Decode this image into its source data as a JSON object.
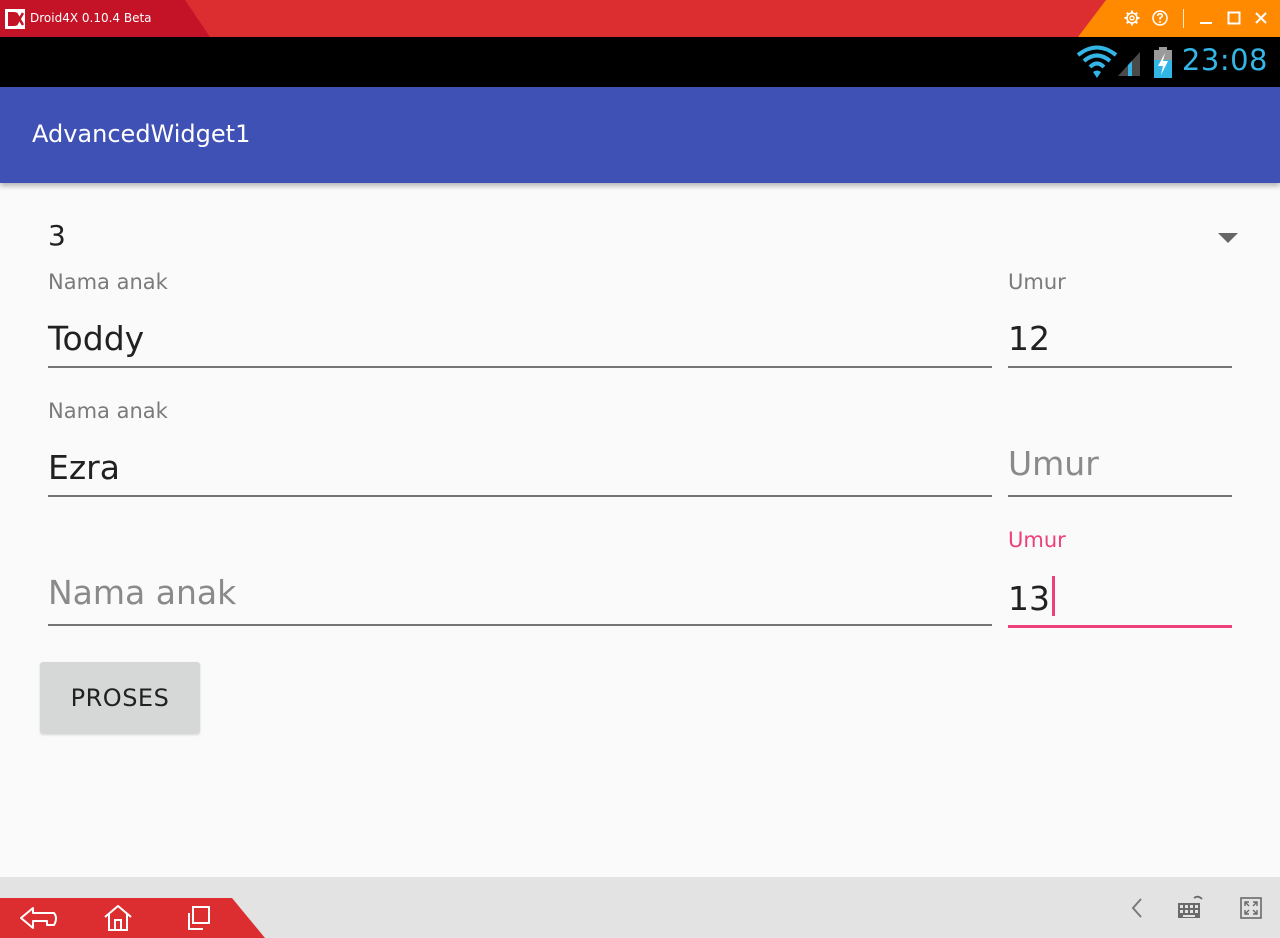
{
  "emulator": {
    "title": "Droid4X 0.10.4 Beta",
    "controls": [
      "gear-icon",
      "help-icon",
      "minimize-icon",
      "maximize-icon",
      "close-icon"
    ],
    "bottom_left_controls": [
      "back-icon",
      "home-icon",
      "recents-icon"
    ],
    "bottom_right_controls": [
      "chevron-left-icon",
      "keyboard-icon",
      "fullscreen-icon"
    ]
  },
  "status_bar": {
    "time": "23:08",
    "icons": [
      "wifi-icon",
      "signal-icon",
      "battery-charging-icon"
    ]
  },
  "app_bar": {
    "title": "AdvancedWidget1"
  },
  "form": {
    "spinner": {
      "selected": "3"
    },
    "rows": [
      {
        "name": {
          "label": "Nama anak",
          "value": "Toddy",
          "hint": ""
        },
        "age": {
          "label": "Umur",
          "value": "12",
          "hint": ""
        }
      },
      {
        "name": {
          "label": "Nama anak",
          "value": "Ezra",
          "hint": ""
        },
        "age": {
          "label": "",
          "value": "",
          "hint": "Umur"
        }
      },
      {
        "name": {
          "label": "",
          "value": "",
          "hint": "Nama anak"
        },
        "age": {
          "label": "Umur",
          "value": "13",
          "hint": "",
          "focused": true
        }
      }
    ],
    "submit_label": "PROSES"
  },
  "colors": {
    "emulator_red": "#dc2e30",
    "emulator_dark_red": "#c41327",
    "emulator_orange": "#ff8a00",
    "app_bar": "#3f51b5",
    "accent": "#ec407a",
    "clock": "#33b5e5",
    "button": "#d6d7d7"
  }
}
